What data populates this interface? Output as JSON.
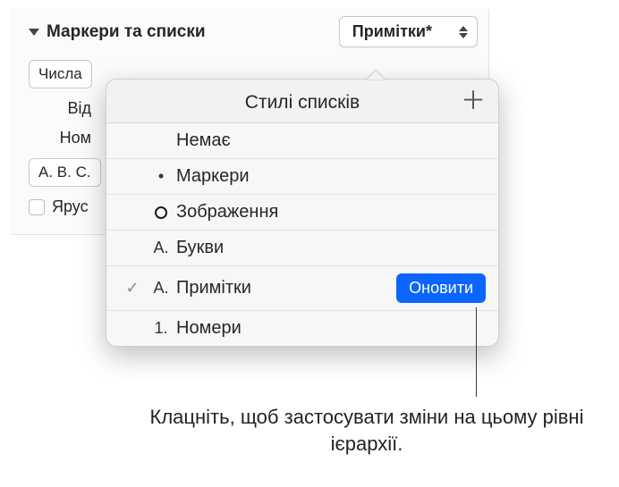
{
  "section": {
    "title": "Маркери та списки",
    "dropdown_value": "Примітки*"
  },
  "left_controls": {
    "numbers_label": "Числа",
    "indent_label": "Від",
    "number_label": "Ном",
    "format_value": "A. B. C.",
    "tier_label": "Ярус"
  },
  "popover": {
    "title": "Стилі списків",
    "items": [
      {
        "icon": "",
        "label": "Немає",
        "selected": false
      },
      {
        "icon": "•",
        "label": "Маркери",
        "selected": false
      },
      {
        "icon": "ring",
        "label": "Зображення",
        "selected": false
      },
      {
        "icon": "A.",
        "label": "Букви",
        "selected": false
      },
      {
        "icon": "A.",
        "label": "Примітки",
        "selected": true,
        "button": "Оновити"
      },
      {
        "icon": "1.",
        "label": "Номери",
        "selected": false
      }
    ]
  },
  "caption": "Клацніть, щоб застосувати зміни на цьому рівні ієрархії."
}
